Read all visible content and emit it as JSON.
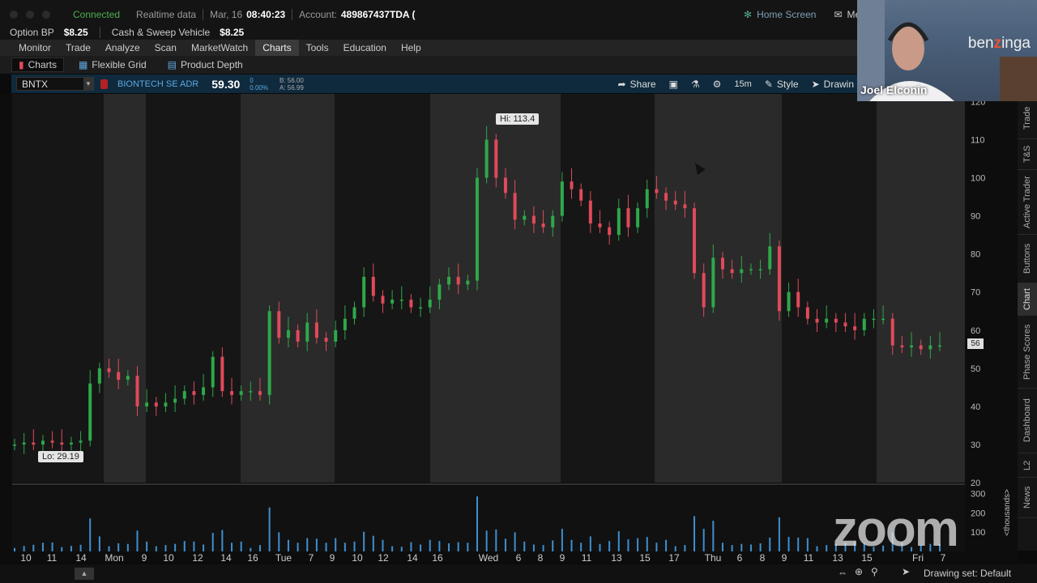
{
  "top_bar": {
    "status": "Connected",
    "data_mode": "Realtime data",
    "date": "Mar, 16",
    "time": "08:40:23",
    "account_label": "Account:",
    "account_value": "489867437TDA (",
    "home_screen": "Home Screen",
    "messages": "Me"
  },
  "bp_bar": {
    "option_bp_label": "Option BP",
    "option_bp_value": "$8.25",
    "cash_label": "Cash & Sweep Vehicle",
    "cash_value": "$8.25"
  },
  "menu": [
    "Monitor",
    "Trade",
    "Analyze",
    "Scan",
    "MarketWatch",
    "Charts",
    "Tools",
    "Education",
    "Help"
  ],
  "menu_active": "Charts",
  "subtabs": [
    "Charts",
    "Flexible Grid",
    "Product Depth"
  ],
  "chart_header": {
    "symbol": "BNTX",
    "company": "BIONTECH SE ADR",
    "last": "59.30",
    "change": "0",
    "change_pct": "0.00%",
    "bid": "B: 56.00",
    "ask": "A: 56.99",
    "share": "Share",
    "timeframe": "15m",
    "style": "Style",
    "drawings": "Drawin"
  },
  "right_tabs": [
    "Trade",
    "T&S",
    "Active Trader",
    "Buttons",
    "Chart",
    "Phase Scores",
    "Dashboard",
    "L2",
    "News"
  ],
  "right_tab_active": "Chart",
  "webcam": {
    "name": "Joel Elconin",
    "brand_pre": "ben",
    "brand_z": "z",
    "brand_post": "inga"
  },
  "watermark": "zoom",
  "bottom": {
    "drawing_set": "Drawing set: Default"
  },
  "colors": {
    "up": "#2ea84a",
    "down": "#e04a5a",
    "volume": "#3f8fcf",
    "header_bg": "#0f2a3d"
  },
  "chart_data": {
    "type": "candlestick",
    "symbol": "BNTX",
    "timeframe": "15m",
    "price_ticks": [
      120,
      110,
      100,
      90,
      80,
      70,
      60,
      50,
      40,
      30,
      20
    ],
    "ylim": [
      20,
      122
    ],
    "volume_ticks": [
      300,
      200,
      100
    ],
    "volume_unit": "<thousands>",
    "x_tick_labels": [
      "10",
      "11",
      "14",
      "Mon",
      "9",
      "10",
      "12",
      "14",
      "16",
      "Tue",
      "7",
      "9",
      "10",
      "12",
      "14",
      "16",
      "Wed",
      "6",
      "8",
      "9",
      "11",
      "13",
      "15",
      "17",
      "Thu",
      "6",
      "8",
      "9",
      "11",
      "13",
      "15",
      "Fri",
      "7"
    ],
    "high_label": "Hi: 113.4",
    "low_label": "Lo: 29.19",
    "high": 113.4,
    "low": 29.19,
    "last_price_tag": "56",
    "price_path": [
      30,
      30.5,
      30,
      31,
      30.5,
      30,
      30.5,
      31,
      46,
      50,
      49,
      47,
      48,
      40,
      41,
      40,
      41,
      42,
      44,
      43,
      45,
      53,
      44,
      43,
      44,
      44,
      43,
      65,
      58,
      60,
      57,
      62,
      58,
      57,
      60,
      63,
      66,
      74,
      69,
      67,
      68,
      68,
      66,
      66,
      68,
      72,
      74,
      72,
      73,
      100,
      110,
      100,
      96,
      89,
      90,
      88,
      87,
      90,
      99,
      97,
      94,
      88,
      87,
      85,
      92,
      87,
      92,
      97,
      96,
      94,
      93,
      92,
      75,
      66,
      79,
      76,
      75,
      76,
      76,
      76,
      82,
      65,
      70,
      66,
      63,
      62,
      63,
      62,
      61,
      60,
      63,
      63,
      63,
      56,
      55.5,
      56,
      55,
      56,
      56
    ]
  }
}
